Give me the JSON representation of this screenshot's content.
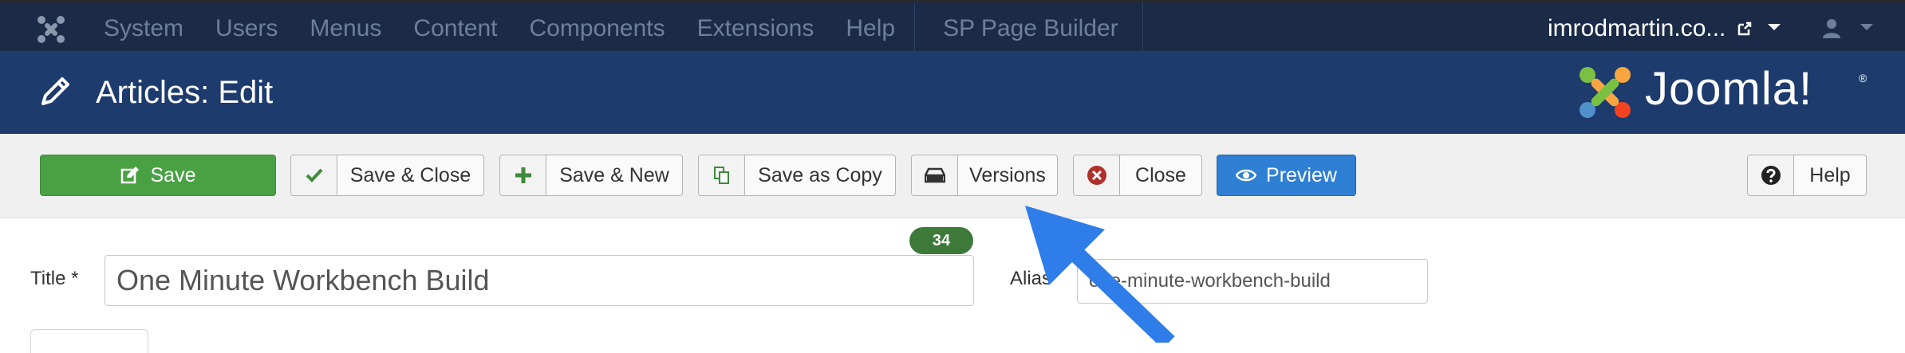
{
  "topnav": {
    "menu": [
      "System",
      "Users",
      "Menus",
      "Content",
      "Components",
      "Extensions",
      "Help"
    ],
    "sp_page_builder": "SP Page Builder",
    "site_name": "imrodmartin.co..."
  },
  "subhead": {
    "title": "Articles: Edit",
    "brand": "Joomla!"
  },
  "toolbar": {
    "save": "Save",
    "save_close": "Save & Close",
    "save_new": "Save & New",
    "save_copy": "Save as Copy",
    "versions": "Versions",
    "close": "Close",
    "preview": "Preview",
    "help": "Help"
  },
  "form": {
    "title_label": "Title *",
    "title_value": "One Minute Workbench Build",
    "title_counter": "34",
    "alias_label": "Alias",
    "alias_value": "one-minute-workbench-build"
  },
  "colors": {
    "topnav_bg": "#1b2b47",
    "subhead_bg": "#1d3b6d",
    "save_green": "#4aa144",
    "preview_blue": "#2f7fd4",
    "arrow_blue": "#2e7de9"
  }
}
